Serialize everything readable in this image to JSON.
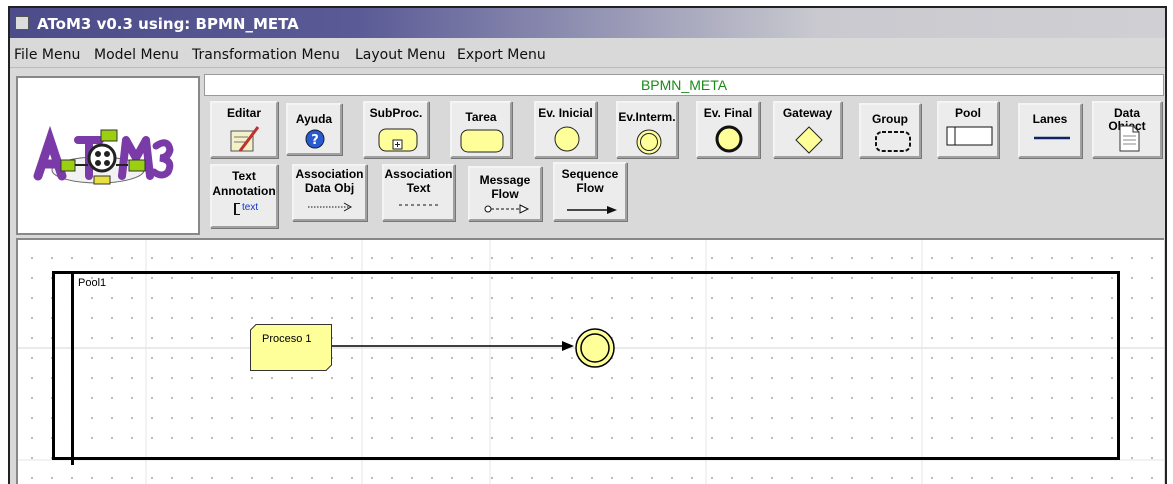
{
  "window": {
    "title": "AToM3 v0.3 using: BPMN_META"
  },
  "menubar": {
    "items": [
      "File Menu",
      "Model Menu",
      "Transformation Menu",
      "Layout Menu",
      "Export Menu"
    ]
  },
  "logo": {
    "icon": "atom3-logo-icon"
  },
  "toolbar": {
    "metamodel_name": "BPMN_META",
    "row1": [
      {
        "label": "Editar",
        "icon": "edit-pencil-icon"
      },
      {
        "label": "Ayuda",
        "icon": "help-question-icon"
      },
      {
        "label": "SubProc.",
        "icon": "subprocess-icon"
      },
      {
        "label": "Tarea",
        "icon": "task-icon"
      },
      {
        "label": "Ev. Inicial",
        "icon": "start-event-icon"
      },
      {
        "label": "Ev.Interm.",
        "icon": "intermediate-event-icon"
      },
      {
        "label": "Ev. Final",
        "icon": "end-event-icon"
      },
      {
        "label": "Gateway",
        "icon": "gateway-diamond-icon"
      },
      {
        "label": "Group",
        "icon": "group-icon"
      },
      {
        "label": "Pool",
        "icon": "pool-icon"
      },
      {
        "label": "Lanes",
        "icon": "lane-line-icon"
      },
      {
        "label": "Data Object",
        "icon": "data-object-icon"
      }
    ],
    "row2": [
      {
        "line1": "Text",
        "line2": "Annotation",
        "sub": "text",
        "icon": "text-annotation-icon"
      },
      {
        "line1": "Association",
        "line2": "Data Obj",
        "icon": "dotted-arrow-icon"
      },
      {
        "line1": "Association",
        "line2": "Text",
        "icon": "dashed-line-icon"
      },
      {
        "line1": "Message",
        "line2": "Flow",
        "icon": "message-flow-icon"
      },
      {
        "line1": "Sequence",
        "line2": "Flow",
        "icon": "sequence-flow-icon"
      }
    ]
  },
  "canvas": {
    "pool_label": "Pool1",
    "task_label": "Proceso 1"
  },
  "colors": {
    "task_fill": "#ffff99",
    "event_fill": "#ffff99",
    "metamodel_title": "#1a8a1a",
    "titlebar": "#4c4c8a"
  }
}
